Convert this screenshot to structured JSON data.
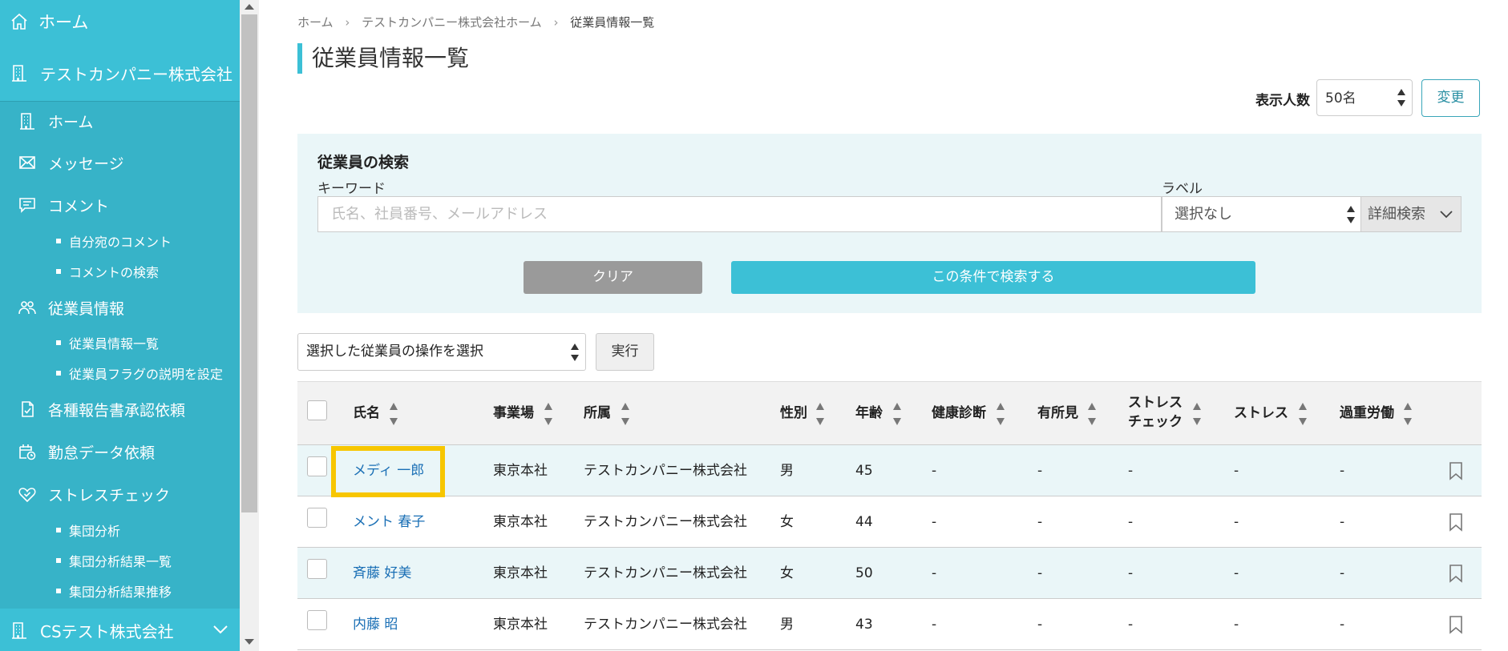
{
  "sidebar": {
    "home": "ホーム",
    "company": "テストカンパニー株式会社",
    "nav": {
      "home": "ホーム",
      "messages": "メッセージ",
      "comments": "コメント",
      "comments_to_me": "自分宛のコメント",
      "comments_search": "コメントの検索",
      "employees": "従業員情報",
      "employee_list": "従業員情報一覧",
      "employee_flags": "従業員フラグの説明を設定",
      "reports": "各種報告書承認依頼",
      "attendance": "勤怠データ依頼",
      "stress_check": "ストレスチェック",
      "group_analysis": "集団分析",
      "group_results": "集団分析結果一覧",
      "group_trend": "集団分析結果推移"
    },
    "bottom_company": "CSテスト株式会社"
  },
  "breadcrumb": {
    "items": [
      "ホーム",
      "テストカンパニー株式会社ホーム",
      "従業員情報一覧"
    ],
    "separator": "›"
  },
  "page_title": "従業員情報一覧",
  "display": {
    "label": "表示人数",
    "value": "50名",
    "change_button": "変更"
  },
  "search": {
    "title": "従業員の検索",
    "keyword_label": "キーワード",
    "keyword_placeholder": "氏名、社員番号、メールアドレス",
    "label_label": "ラベル",
    "label_value": "選択なし",
    "advanced_button": "詳細検索",
    "clear_button": "クリア",
    "submit_button": "この条件で検索する"
  },
  "bulk_action": {
    "select_value": "選択した従業員の操作を選択",
    "execute_button": "実行"
  },
  "table": {
    "headers": {
      "name": "氏名",
      "office": "事業場",
      "department": "所属",
      "gender": "性別",
      "age": "年齢",
      "health_check": "健康診断",
      "findings": "有所見",
      "stress_check_line1": "ストレス",
      "stress_check_line2": "チェック",
      "stress": "ストレス",
      "overwork": "過重労働"
    },
    "rows": [
      {
        "name": "メディ 一郎",
        "office": "東京本社",
        "department": "テストカンパニー株式会社",
        "gender": "男",
        "age": "45",
        "health_check": "-",
        "findings": "-",
        "stress_check": "-",
        "stress": "-",
        "overwork": "-"
      },
      {
        "name": "メント 春子",
        "office": "東京本社",
        "department": "テストカンパニー株式会社",
        "gender": "女",
        "age": "44",
        "health_check": "-",
        "findings": "-",
        "stress_check": "-",
        "stress": "-",
        "overwork": "-"
      },
      {
        "name": "斉藤 好美",
        "office": "東京本社",
        "department": "テストカンパニー株式会社",
        "gender": "女",
        "age": "50",
        "health_check": "-",
        "findings": "-",
        "stress_check": "-",
        "stress": "-",
        "overwork": "-"
      },
      {
        "name": "内藤 昭",
        "office": "東京本社",
        "department": "テストカンパニー株式会社",
        "gender": "男",
        "age": "43",
        "health_check": "-",
        "findings": "-",
        "stress_check": "-",
        "stress": "-",
        "overwork": "-"
      }
    ]
  },
  "colors": {
    "sidebar_bg": "#37b3c8",
    "accent": "#3cc0d6",
    "panel_bg": "#eaf6f8",
    "link": "#1a6fb5",
    "highlight": "#f7c600"
  }
}
